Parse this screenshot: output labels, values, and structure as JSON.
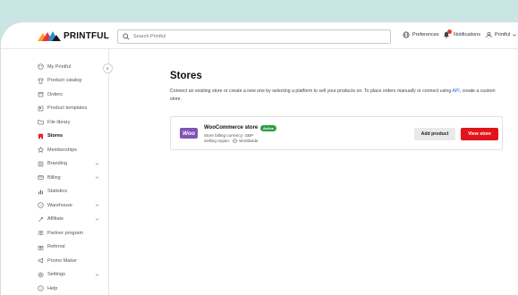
{
  "topbar": {
    "brand": "PRINTFUL",
    "search_placeholder": "Search Printful",
    "preferences_label": "Preferences",
    "notifications_label": "Notifications",
    "account_label": "Printful"
  },
  "sidebar": {
    "items": [
      {
        "label": "My Printful",
        "icon": "palette-icon"
      },
      {
        "label": "Product catalog",
        "icon": "shirt-icon"
      },
      {
        "label": "Orders",
        "icon": "box-icon"
      },
      {
        "label": "Product templates",
        "icon": "template-icon"
      },
      {
        "label": "File library",
        "icon": "folder-icon"
      },
      {
        "label": "Stores",
        "icon": "store-icon",
        "active": true
      },
      {
        "label": "Memberships",
        "icon": "membership-icon"
      },
      {
        "label": "Branding",
        "icon": "branding-icon",
        "expandable": true
      },
      {
        "label": "Billing",
        "icon": "billing-icon",
        "expandable": true
      },
      {
        "label": "Statistics",
        "icon": "chart-icon"
      },
      {
        "label": "Warehouse",
        "icon": "warehouse-icon",
        "expandable": true
      },
      {
        "label": "Affiliate",
        "icon": "affiliate-icon",
        "expandable": true
      },
      {
        "label": "Partner program",
        "icon": "partner-icon"
      },
      {
        "label": "Referral",
        "icon": "gift-icon"
      },
      {
        "label": "Promo Maker",
        "icon": "megaphone-icon"
      },
      {
        "label": "Settings",
        "icon": "gear-icon",
        "expandable": true
      },
      {
        "label": "Help",
        "icon": "help-icon"
      }
    ]
  },
  "main": {
    "title": "Stores",
    "description_part1": "Connect an existing store or create a new one by selecting a platform to sell your products on. To place orders manually or connect using ",
    "description_link": "API",
    "description_part2": ", create a custom store.",
    "store": {
      "logo_text": "Woo",
      "name": "WooCommerce store",
      "status": "Active",
      "billing": "Store billing currency: GBP",
      "region_label": "Selling region:",
      "region_value": "Worldwide",
      "add_product_label": "Add product",
      "view_store_label": "View store"
    }
  },
  "colors": {
    "accent_red": "#e1131b",
    "active_green": "#2e9e44",
    "woo_purple": "#7f54b3",
    "background_teal": "#c9e6e5"
  }
}
